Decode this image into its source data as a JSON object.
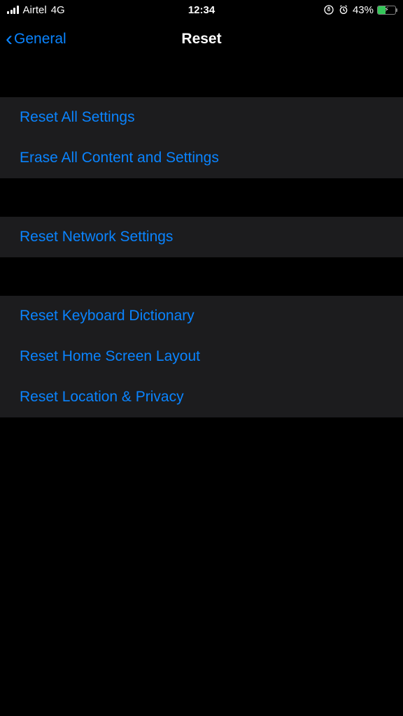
{
  "status": {
    "carrier": "Airtel",
    "network": "4G",
    "time": "12:34",
    "battery_pct": "43%"
  },
  "nav": {
    "back_label": "General",
    "title": "Reset"
  },
  "groups": [
    {
      "items": [
        {
          "label": "Reset All Settings"
        },
        {
          "label": "Erase All Content and Settings"
        }
      ]
    },
    {
      "items": [
        {
          "label": "Reset Network Settings"
        }
      ]
    },
    {
      "items": [
        {
          "label": "Reset Keyboard Dictionary"
        },
        {
          "label": "Reset Home Screen Layout"
        },
        {
          "label": "Reset Location & Privacy"
        }
      ]
    }
  ]
}
